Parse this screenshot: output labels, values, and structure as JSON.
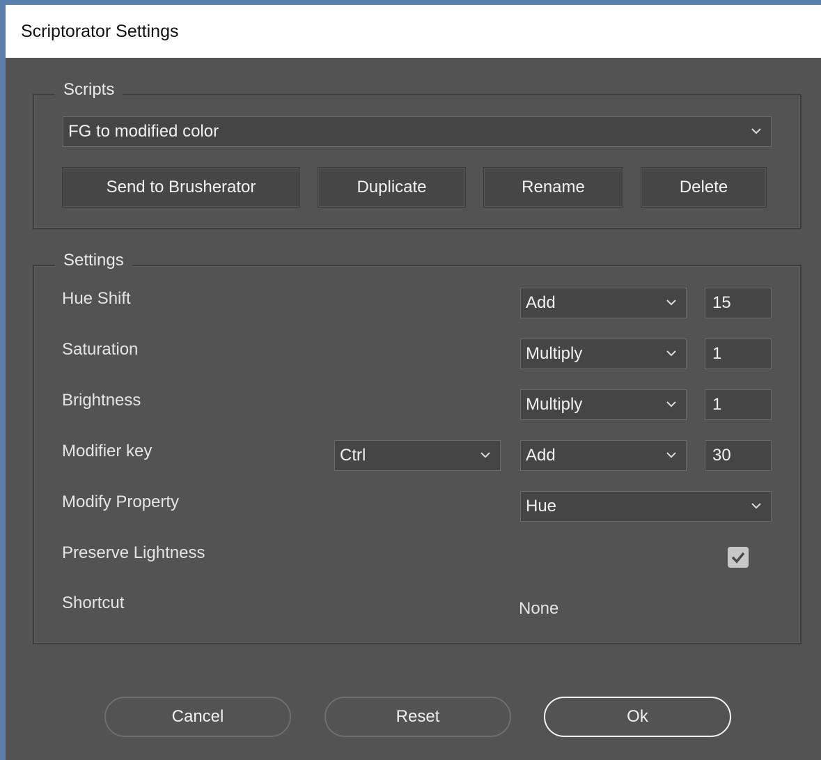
{
  "window": {
    "title": "Scriptorator Settings"
  },
  "scripts": {
    "legend": "Scripts",
    "selected": "FG to modified color",
    "buttons": {
      "send": "Send to Brusherator",
      "duplicate": "Duplicate",
      "rename": "Rename",
      "delete": "Delete"
    }
  },
  "settings": {
    "legend": "Settings",
    "hue_shift": {
      "label": "Hue Shift",
      "mode": "Add",
      "value": "15"
    },
    "saturation": {
      "label": "Saturation",
      "mode": "Multiply",
      "value": "1"
    },
    "brightness": {
      "label": "Brightness",
      "mode": "Multiply",
      "value": "1"
    },
    "modifier_key": {
      "label": "Modifier key",
      "key": "Ctrl",
      "mode": "Add",
      "value": "30"
    },
    "modify_property": {
      "label": "Modify Property",
      "value": "Hue"
    },
    "preserve_lightness": {
      "label": "Preserve Lightness",
      "checked": true
    },
    "shortcut": {
      "label": "Shortcut",
      "value": "None"
    }
  },
  "footer": {
    "cancel": "Cancel",
    "reset": "Reset",
    "ok": "Ok"
  }
}
